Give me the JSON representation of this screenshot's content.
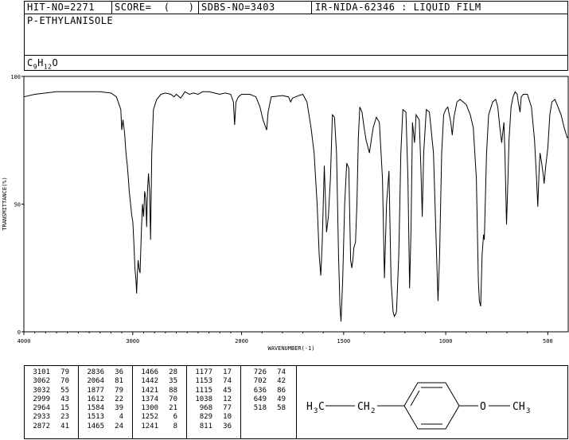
{
  "header": {
    "hit_no": "HIT-NO=2271",
    "score": "SCORE=  (   )",
    "sdbs_no": "SDBS-NO=3403",
    "ir_no": "IR-NIDA-62346 : LIQUID FILM",
    "compound_name": "P-ETHYLANISOLE",
    "formula_c": "C",
    "formula_c_sub": "9",
    "formula_h": "H",
    "formula_h_sub": "12",
    "formula_o": "O"
  },
  "chart_data": {
    "type": "line",
    "xlabel": "WAVENUMBER(-1)",
    "ylabel": "TRANSMITTANCE(%)",
    "xlim": [
      4000,
      400
    ],
    "ylim": [
      0,
      100
    ],
    "x_ticks": [
      4000,
      3000,
      2000,
      1500,
      1000,
      500
    ],
    "x_tick_labels": [
      "4000",
      "3000",
      "2000",
      "1500",
      "1000",
      "500"
    ],
    "y_ticks": [
      0,
      50,
      100
    ],
    "y_tick_labels": [
      "0",
      "50",
      "100"
    ],
    "series": [
      {
        "points": [
          [
            4000,
            92
          ],
          [
            3900,
            93
          ],
          [
            3800,
            93.5
          ],
          [
            3700,
            94
          ],
          [
            3600,
            94
          ],
          [
            3500,
            94
          ],
          [
            3400,
            94
          ],
          [
            3300,
            94
          ],
          [
            3200,
            93.5
          ],
          [
            3150,
            92
          ],
          [
            3110,
            87
          ],
          [
            3101,
            79
          ],
          [
            3090,
            83
          ],
          [
            3075,
            78
          ],
          [
            3062,
            70
          ],
          [
            3050,
            65
          ],
          [
            3040,
            60
          ],
          [
            3032,
            55
          ],
          [
            3020,
            50
          ],
          [
            3010,
            46
          ],
          [
            2999,
            43
          ],
          [
            2990,
            35
          ],
          [
            2980,
            25
          ],
          [
            2970,
            20
          ],
          [
            2964,
            15
          ],
          [
            2958,
            22
          ],
          [
            2950,
            28
          ],
          [
            2943,
            25
          ],
          [
            2933,
            23
          ],
          [
            2920,
            40
          ],
          [
            2910,
            50
          ],
          [
            2900,
            45
          ],
          [
            2890,
            55
          ],
          [
            2880,
            52
          ],
          [
            2872,
            41
          ],
          [
            2865,
            55
          ],
          [
            2855,
            62
          ],
          [
            2845,
            55
          ],
          [
            2836,
            36
          ],
          [
            2825,
            70
          ],
          [
            2810,
            87
          ],
          [
            2780,
            91
          ],
          [
            2740,
            93
          ],
          [
            2700,
            93.5
          ],
          [
            2650,
            93
          ],
          [
            2620,
            92
          ],
          [
            2600,
            93
          ],
          [
            2560,
            91.5
          ],
          [
            2520,
            94
          ],
          [
            2480,
            93
          ],
          [
            2440,
            93.5
          ],
          [
            2400,
            93
          ],
          [
            2360,
            94
          ],
          [
            2300,
            94
          ],
          [
            2250,
            93.5
          ],
          [
            2200,
            93
          ],
          [
            2150,
            93.5
          ],
          [
            2100,
            93
          ],
          [
            2075,
            90
          ],
          [
            2064,
            81
          ],
          [
            2052,
            90
          ],
          [
            2030,
            92
          ],
          [
            2000,
            93
          ],
          [
            1960,
            93
          ],
          [
            1930,
            92
          ],
          [
            1910,
            88
          ],
          [
            1895,
            83
          ],
          [
            1877,
            79
          ],
          [
            1870,
            86
          ],
          [
            1855,
            92
          ],
          [
            1800,
            92.5
          ],
          [
            1770,
            92
          ],
          [
            1760,
            90
          ],
          [
            1750,
            91.5
          ],
          [
            1720,
            92.5
          ],
          [
            1700,
            93
          ],
          [
            1680,
            90
          ],
          [
            1660,
            80
          ],
          [
            1645,
            70
          ],
          [
            1630,
            50
          ],
          [
            1620,
            30
          ],
          [
            1612,
            22
          ],
          [
            1605,
            35
          ],
          [
            1595,
            65
          ],
          [
            1584,
            39
          ],
          [
            1575,
            45
          ],
          [
            1565,
            60
          ],
          [
            1555,
            85
          ],
          [
            1545,
            84
          ],
          [
            1535,
            70
          ],
          [
            1525,
            30
          ],
          [
            1518,
            10
          ],
          [
            1513,
            4
          ],
          [
            1505,
            20
          ],
          [
            1495,
            50
          ],
          [
            1485,
            66
          ],
          [
            1475,
            64
          ],
          [
            1466,
            28
          ],
          [
            1460,
            25
          ],
          [
            1455,
            28
          ],
          [
            1450,
            33
          ],
          [
            1442,
            35
          ],
          [
            1435,
            50
          ],
          [
            1428,
            76
          ],
          [
            1421,
            88
          ],
          [
            1410,
            86
          ],
          [
            1400,
            80
          ],
          [
            1390,
            75
          ],
          [
            1380,
            72
          ],
          [
            1374,
            70
          ],
          [
            1365,
            75
          ],
          [
            1355,
            80
          ],
          [
            1340,
            84
          ],
          [
            1325,
            82
          ],
          [
            1310,
            60
          ],
          [
            1300,
            21
          ],
          [
            1290,
            50
          ],
          [
            1278,
            63
          ],
          [
            1268,
            20
          ],
          [
            1258,
            8
          ],
          [
            1252,
            6
          ],
          [
            1245,
            7
          ],
          [
            1241,
            8
          ],
          [
            1230,
            30
          ],
          [
            1220,
            70
          ],
          [
            1210,
            87
          ],
          [
            1195,
            86
          ],
          [
            1185,
            60
          ],
          [
            1177,
            17
          ],
          [
            1170,
            40
          ],
          [
            1163,
            82
          ],
          [
            1153,
            74
          ],
          [
            1145,
            85
          ],
          [
            1130,
            83
          ],
          [
            1122,
            65
          ],
          [
            1115,
            45
          ],
          [
            1108,
            70
          ],
          [
            1095,
            87
          ],
          [
            1080,
            86
          ],
          [
            1060,
            70
          ],
          [
            1045,
            30
          ],
          [
            1038,
            12
          ],
          [
            1030,
            30
          ],
          [
            1020,
            70
          ],
          [
            1010,
            85
          ],
          [
            1000,
            87
          ],
          [
            990,
            88
          ],
          [
            975,
            82
          ],
          [
            968,
            77
          ],
          [
            960,
            84
          ],
          [
            945,
            90
          ],
          [
            930,
            91
          ],
          [
            915,
            90
          ],
          [
            900,
            89
          ],
          [
            880,
            85
          ],
          [
            865,
            80
          ],
          [
            850,
            60
          ],
          [
            840,
            20
          ],
          [
            835,
            12
          ],
          [
            829,
            10
          ],
          [
            822,
            30
          ],
          [
            815,
            38
          ],
          [
            811,
            36
          ],
          [
            800,
            70
          ],
          [
            790,
            85
          ],
          [
            770,
            90
          ],
          [
            755,
            91
          ],
          [
            745,
            88
          ],
          [
            735,
            80
          ],
          [
            726,
            74
          ],
          [
            715,
            82
          ],
          [
            710,
            70
          ],
          [
            702,
            42
          ],
          [
            695,
            60
          ],
          [
            690,
            75
          ],
          [
            680,
            88
          ],
          [
            670,
            92
          ],
          [
            660,
            94
          ],
          [
            650,
            93
          ],
          [
            645,
            90
          ],
          [
            636,
            86
          ],
          [
            630,
            92
          ],
          [
            620,
            93
          ],
          [
            600,
            93
          ],
          [
            580,
            88
          ],
          [
            565,
            75
          ],
          [
            555,
            60
          ],
          [
            549,
            49
          ],
          [
            543,
            62
          ],
          [
            538,
            70
          ],
          [
            530,
            66
          ],
          [
            520,
            60
          ],
          [
            518,
            58
          ],
          [
            510,
            65
          ],
          [
            500,
            72
          ],
          [
            490,
            85
          ],
          [
            480,
            90
          ],
          [
            465,
            91
          ],
          [
            450,
            88
          ],
          [
            435,
            85
          ],
          [
            420,
            80
          ],
          [
            405,
            76
          ],
          [
            400,
            76
          ]
        ]
      }
    ],
    "peak_table": [
      [
        {
          "wavenumber": "3101",
          "transmittance": "79"
        },
        {
          "wavenumber": "3062",
          "transmittance": "70"
        },
        {
          "wavenumber": "3032",
          "transmittance": "55"
        },
        {
          "wavenumber": "2999",
          "transmittance": "43"
        },
        {
          "wavenumber": "2964",
          "transmittance": "15"
        },
        {
          "wavenumber": "2933",
          "transmittance": "23"
        },
        {
          "wavenumber": "2872",
          "transmittance": "41"
        }
      ],
      [
        {
          "wavenumber": "2836",
          "transmittance": "36"
        },
        {
          "wavenumber": "2064",
          "transmittance": "81"
        },
        {
          "wavenumber": "1877",
          "transmittance": "79"
        },
        {
          "wavenumber": "1612",
          "transmittance": "22"
        },
        {
          "wavenumber": "1584",
          "transmittance": "39"
        },
        {
          "wavenumber": "1513",
          "transmittance": "4"
        },
        {
          "wavenumber": "1465",
          "transmittance": "24"
        }
      ],
      [
        {
          "wavenumber": "1466",
          "transmittance": "28"
        },
        {
          "wavenumber": "1442",
          "transmittance": "35"
        },
        {
          "wavenumber": "1421",
          "transmittance": "88"
        },
        {
          "wavenumber": "1374",
          "transmittance": "70"
        },
        {
          "wavenumber": "1300",
          "transmittance": "21"
        },
        {
          "wavenumber": "1252",
          "transmittance": "6"
        },
        {
          "wavenumber": "1241",
          "transmittance": "8"
        }
      ],
      [
        {
          "wavenumber": "1177",
          "transmittance": "17"
        },
        {
          "wavenumber": "1153",
          "transmittance": "74"
        },
        {
          "wavenumber": "1115",
          "transmittance": "45"
        },
        {
          "wavenumber": "1038",
          "transmittance": "12"
        },
        {
          "wavenumber": "968",
          "transmittance": "77"
        },
        {
          "wavenumber": "829",
          "transmittance": "10"
        },
        {
          "wavenumber": "811",
          "transmittance": "36"
        }
      ],
      [
        {
          "wavenumber": "726",
          "transmittance": "74"
        },
        {
          "wavenumber": "702",
          "transmittance": "42"
        },
        {
          "wavenumber": "636",
          "transmittance": "86"
        },
        {
          "wavenumber": "649",
          "transmittance": "49"
        },
        {
          "wavenumber": "518",
          "transmittance": "58"
        }
      ]
    ]
  },
  "structure": {
    "left_group_h": "H",
    "left_group_sub": "3",
    "left_group_c": "C",
    "middle_group_ch": "CH",
    "middle_group_sub": "2",
    "right_group_o": "O",
    "right_group_ch": "CH",
    "right_group_sub": "3"
  }
}
